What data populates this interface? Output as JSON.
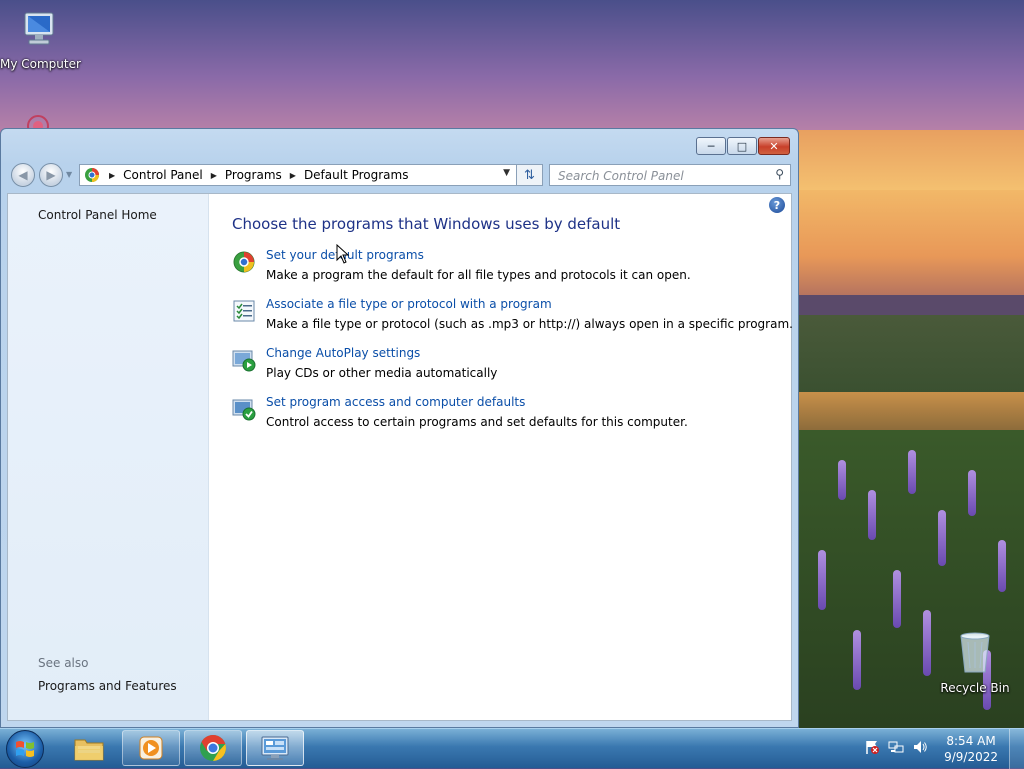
{
  "desktop": {
    "icons": [
      {
        "label": "My Computer"
      },
      {
        "label": "Recycle Bin"
      }
    ]
  },
  "window": {
    "caption_buttons": {
      "minimize": "minimize",
      "maximize": "maximize",
      "close": "close"
    },
    "nav": {
      "breadcrumbs": [
        "Control Panel",
        "Programs",
        "Default Programs"
      ],
      "search_placeholder": "Search Control Panel"
    },
    "left_pane": {
      "home_link": "Control Panel Home",
      "see_also_heading": "See also",
      "see_also_items": [
        "Programs and Features"
      ]
    },
    "main": {
      "heading": "Choose the programs that Windows uses by default",
      "tasks": [
        {
          "icon": "default-programs-icon",
          "link": "Set your default programs",
          "description": "Make a program the default for all file types and protocols it can open."
        },
        {
          "icon": "file-association-icon",
          "link": "Associate a file type or protocol with a program",
          "description": "Make a file type or protocol (such as .mp3 or http://) always open in a specific program."
        },
        {
          "icon": "autoplay-icon",
          "link": "Change AutoPlay settings",
          "description": "Play CDs or other media automatically"
        },
        {
          "icon": "program-access-icon",
          "link": "Set program access and computer defaults",
          "description": "Control access to certain programs and set defaults for this computer."
        }
      ]
    }
  },
  "taskbar": {
    "items": [
      {
        "name": "explorer",
        "icon": "folder-icon",
        "state": "pinned"
      },
      {
        "name": "media-player",
        "icon": "media-player-icon",
        "state": "running"
      },
      {
        "name": "chrome",
        "icon": "chrome-icon",
        "state": "running"
      },
      {
        "name": "control-panel",
        "icon": "control-panel-icon",
        "state": "active"
      }
    ],
    "clock": {
      "time": "8:54 AM",
      "date": "9/9/2022"
    }
  },
  "colors": {
    "link": "#0a4ea8",
    "heading": "#1e3287",
    "taskbar": "#245c94"
  }
}
